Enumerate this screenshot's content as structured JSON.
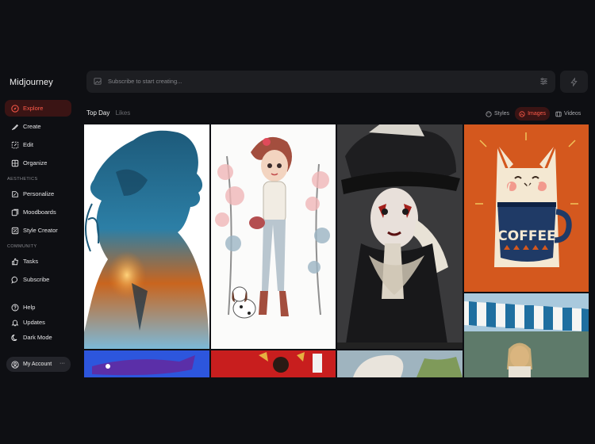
{
  "app": {
    "title": "Midjourney"
  },
  "sidebar": {
    "main_items": [
      {
        "label": "Explore",
        "icon": "compass-icon"
      },
      {
        "label": "Create",
        "icon": "brush-icon"
      },
      {
        "label": "Edit",
        "icon": "edit-frame-icon"
      },
      {
        "label": "Organize",
        "icon": "grid-icon"
      }
    ],
    "aesthetics_label": "AESTHETICS",
    "aesthetics_items": [
      {
        "label": "Personalize",
        "icon": "personalize-icon"
      },
      {
        "label": "Moodboards",
        "icon": "moodboard-icon"
      },
      {
        "label": "Style Creator",
        "icon": "palette-icon"
      }
    ],
    "community_label": "COMMUNITY",
    "community_items": [
      {
        "label": "Tasks",
        "icon": "thumbs-up-icon"
      },
      {
        "label": "Subscribe",
        "icon": "chat-bubble-icon"
      }
    ],
    "bottom_items": [
      {
        "label": "Help",
        "icon": "help-icon"
      },
      {
        "label": "Updates",
        "icon": "bell-icon"
      },
      {
        "label": "Dark Mode",
        "icon": "moon-icon"
      }
    ],
    "account_label": "My Account",
    "account_more": "···"
  },
  "search": {
    "placeholder": "Subscribe to start creating..."
  },
  "feed_tabs": {
    "top_day": "Top Day",
    "likes": "Likes"
  },
  "view_tabs": {
    "styles": "Styles",
    "images": "Images",
    "videos": "Videos"
  },
  "gallery": {
    "coffee_text": "COFFEE"
  },
  "colors": {
    "accent": "#ff5a4a",
    "active_bg": "#3a1414",
    "panel": "#1d1e22",
    "background": "#0e0f13"
  }
}
